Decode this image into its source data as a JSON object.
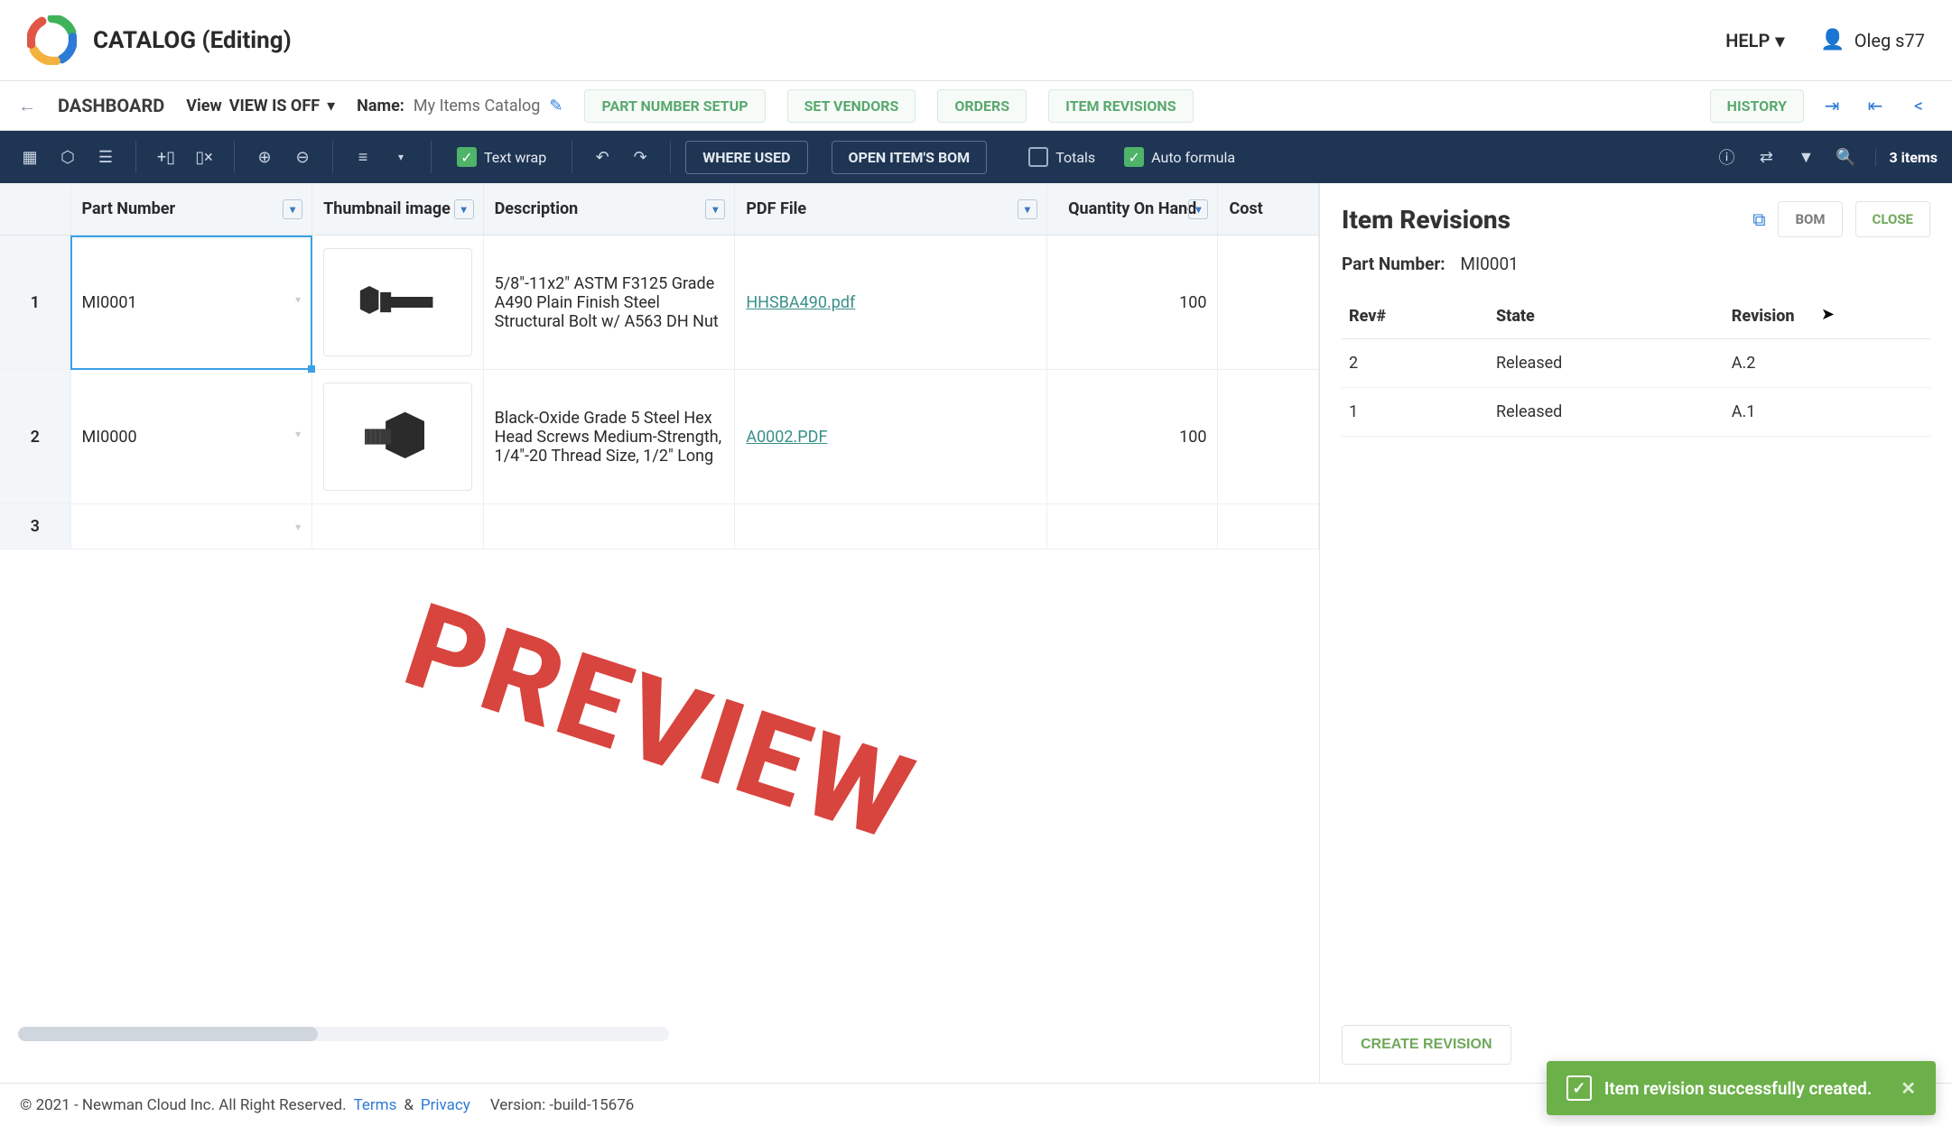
{
  "app": {
    "title": "CATALOG (Editing)",
    "help_label": "HELP",
    "user_name": "Oleg s77"
  },
  "subnav": {
    "dashboard": "DASHBOARD",
    "view_label": "View",
    "view_value": "VIEW IS OFF",
    "name_label": "Name:",
    "name_value": "My Items Catalog",
    "buttons": {
      "part_number_setup": "PART NUMBER SETUP",
      "set_vendors": "SET VENDORS",
      "orders": "ORDERS",
      "item_revisions": "ITEM REVISIONS",
      "history": "HISTORY"
    }
  },
  "toolbar": {
    "text_wrap": "Text wrap",
    "where_used": "WHERE USED",
    "open_bom": "OPEN ITEM'S BOM",
    "totals": "Totals",
    "auto_formula": "Auto formula",
    "item_count": "3 items"
  },
  "columns": {
    "part_number": "Part Number",
    "thumbnail": "Thumbnail image",
    "description": "Description",
    "pdf": "PDF File",
    "qty": "Quantity On Hand",
    "cost": "Cost"
  },
  "rows": [
    {
      "idx": "1",
      "part_number": "MI0001",
      "description": "5/8\"-11x2\" ASTM F3125 Grade A490 Plain Finish Steel Structural Bolt w/ A563 DH Nut",
      "pdf": "HHSBA490.pdf",
      "qty": "100",
      "cost": ""
    },
    {
      "idx": "2",
      "part_number": "MI0000",
      "description": "Black-Oxide Grade 5 Steel Hex Head Screws Medium-Strength, 1/4\"-20 Thread Size, 1/2\" Long",
      "pdf": "A0002.PDF",
      "qty": "100",
      "cost": ""
    },
    {
      "idx": "3",
      "part_number": "",
      "description": "",
      "pdf": "",
      "qty": "",
      "cost": ""
    }
  ],
  "watermark": "PREVIEW",
  "side": {
    "title": "Item Revisions",
    "bom": "BOM",
    "close": "CLOSE",
    "part_number_label": "Part Number:",
    "part_number_value": "MI0001",
    "columns": {
      "rev": "Rev#",
      "state": "State",
      "revision": "Revision"
    },
    "rows": [
      {
        "rev": "2",
        "state": "Released",
        "revision": "A.2"
      },
      {
        "rev": "1",
        "state": "Released",
        "revision": "A.1"
      }
    ],
    "create": "CREATE REVISION"
  },
  "toast": {
    "message": "Item revision successfully created."
  },
  "footer": {
    "copyright": "© 2021 - Newman Cloud Inc. All Right Reserved.",
    "terms": "Terms",
    "amp": "&",
    "privacy": "Privacy",
    "version_label": "Version:",
    "version_value": "-build-15676"
  }
}
